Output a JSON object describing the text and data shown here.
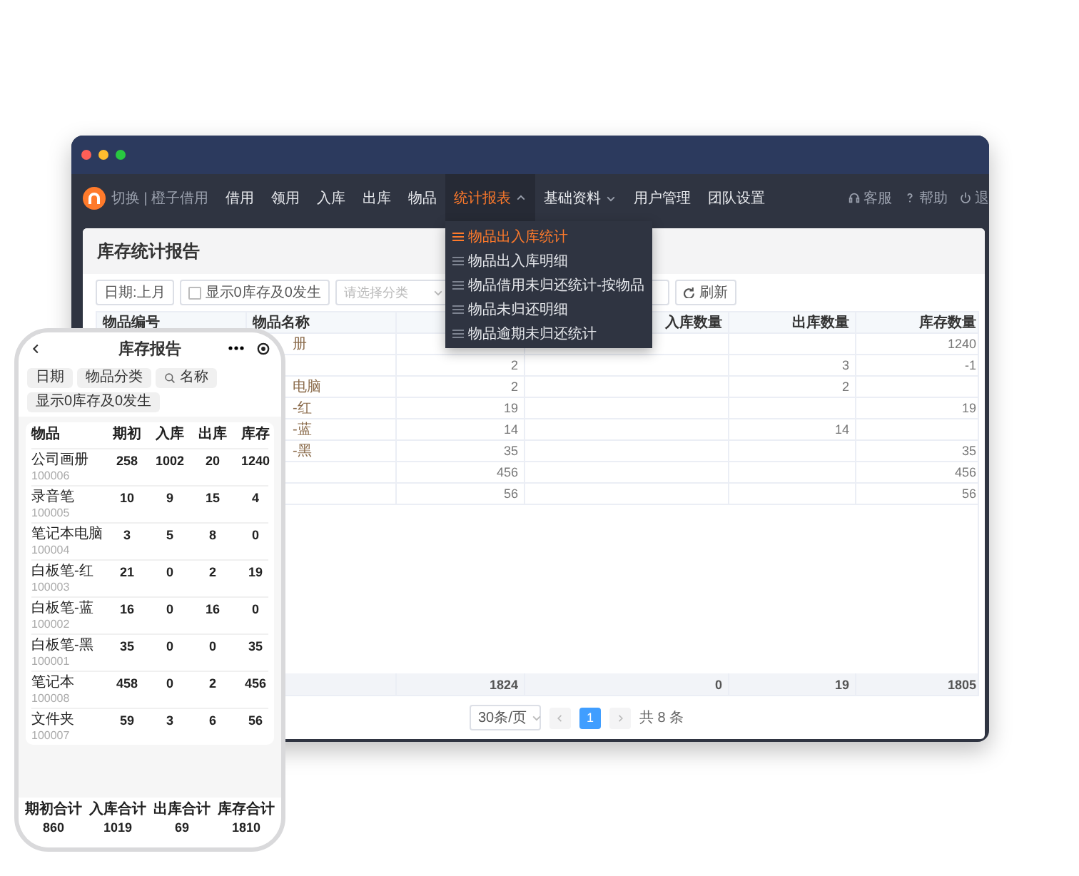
{
  "browser": {
    "nav": {
      "brand": "切换 | 橙子借用",
      "items": [
        {
          "label": "借用",
          "selected": false
        },
        {
          "label": "领用",
          "selected": false
        },
        {
          "label": "入库",
          "selected": false
        },
        {
          "label": "出库",
          "selected": false
        },
        {
          "label": "物品",
          "selected": false
        },
        {
          "label": "统计报表",
          "selected": true,
          "expanded": true
        },
        {
          "label": "基础资料",
          "selected": false,
          "expanded": false
        },
        {
          "label": "用户管理",
          "selected": false
        },
        {
          "label": "团队设置",
          "selected": false
        }
      ],
      "links": [
        {
          "kind": "headset",
          "label": "客服"
        },
        {
          "kind": "help",
          "label": "帮助"
        },
        {
          "kind": "power",
          "label": "退"
        }
      ]
    },
    "menu": [
      {
        "label": "物品出入库统计",
        "selected": true
      },
      {
        "label": "物品出入库明细",
        "selected": false
      },
      {
        "label": "物品借用未归还统计-按物品",
        "selected": false
      },
      {
        "label": "物品未归还明细",
        "selected": false
      },
      {
        "label": "物品逾期未归还统计",
        "selected": false
      }
    ],
    "page_title": "库存统计报告",
    "filters": {
      "date": "日期:上月",
      "zero_checkbox": {
        "label": "显示0库存及0发生",
        "checked": false
      },
      "category": {
        "placeholder": "请选择分类"
      },
      "refresh": "刷新"
    },
    "table": {
      "columns": {
        "code": "物品编号",
        "name": "物品名称",
        "in": "入库数量",
        "out": "出库数量",
        "stock": "库存数量"
      },
      "rows": [
        {
          "name": "册",
          "stock": "1240"
        },
        {
          "opening": "2",
          "out": "3",
          "stock": "-1"
        },
        {
          "name": "电脑",
          "opening": "2",
          "out": "2"
        },
        {
          "name": "-红",
          "opening": "19",
          "stock": "19"
        },
        {
          "name": "-蓝",
          "opening": "14",
          "out": "14"
        },
        {
          "name": "-黑",
          "opening": "35",
          "stock": "35"
        },
        {
          "opening": "456",
          "stock": "456"
        },
        {
          "opening": "56",
          "stock": "56"
        }
      ],
      "totals": {
        "opening": "1824",
        "in": "0",
        "out": "19",
        "stock": "1805"
      }
    },
    "pagination": {
      "page_size": "30条/页",
      "pages": [
        {
          "label": "1",
          "selected": true
        }
      ],
      "total": "共 8 条"
    }
  },
  "phone": {
    "title": "库存报告",
    "chips": [
      {
        "kind": "plain",
        "label": "日期"
      },
      {
        "kind": "plain",
        "label": "物品分类"
      },
      {
        "kind": "search",
        "label": "名称"
      },
      {
        "kind": "plain",
        "label": "显示0库存及0发生"
      }
    ],
    "columns": [
      "物品",
      "期初",
      "入库",
      "出库",
      "库存"
    ],
    "rows": [
      {
        "name": "公司画册",
        "code": "100006",
        "values": [
          "258",
          "1002",
          "20",
          "1240"
        ]
      },
      {
        "name": "录音笔",
        "code": "100005",
        "values": [
          "10",
          "9",
          "15",
          "4"
        ]
      },
      {
        "name": "笔记本电脑",
        "code": "100004",
        "values": [
          "3",
          "5",
          "8",
          "0"
        ]
      },
      {
        "name": "白板笔-红",
        "code": "100003",
        "values": [
          "21",
          "0",
          "2",
          "19"
        ]
      },
      {
        "name": "白板笔-蓝",
        "code": "100002",
        "values": [
          "16",
          "0",
          "16",
          "0"
        ]
      },
      {
        "name": "白板笔-黑",
        "code": "100001",
        "values": [
          "35",
          "0",
          "0",
          "35"
        ]
      },
      {
        "name": "笔记本",
        "code": "100008",
        "values": [
          "458",
          "0",
          "2",
          "456"
        ]
      },
      {
        "name": "文件夹",
        "code": "100007",
        "values": [
          "59",
          "3",
          "6",
          "56"
        ]
      }
    ],
    "totals": [
      {
        "label": "期初合计",
        "value": "860"
      },
      {
        "label": "入库合计",
        "value": "1019"
      },
      {
        "label": "出库合计",
        "value": "69"
      },
      {
        "label": "库存合计",
        "value": "1810"
      }
    ]
  }
}
